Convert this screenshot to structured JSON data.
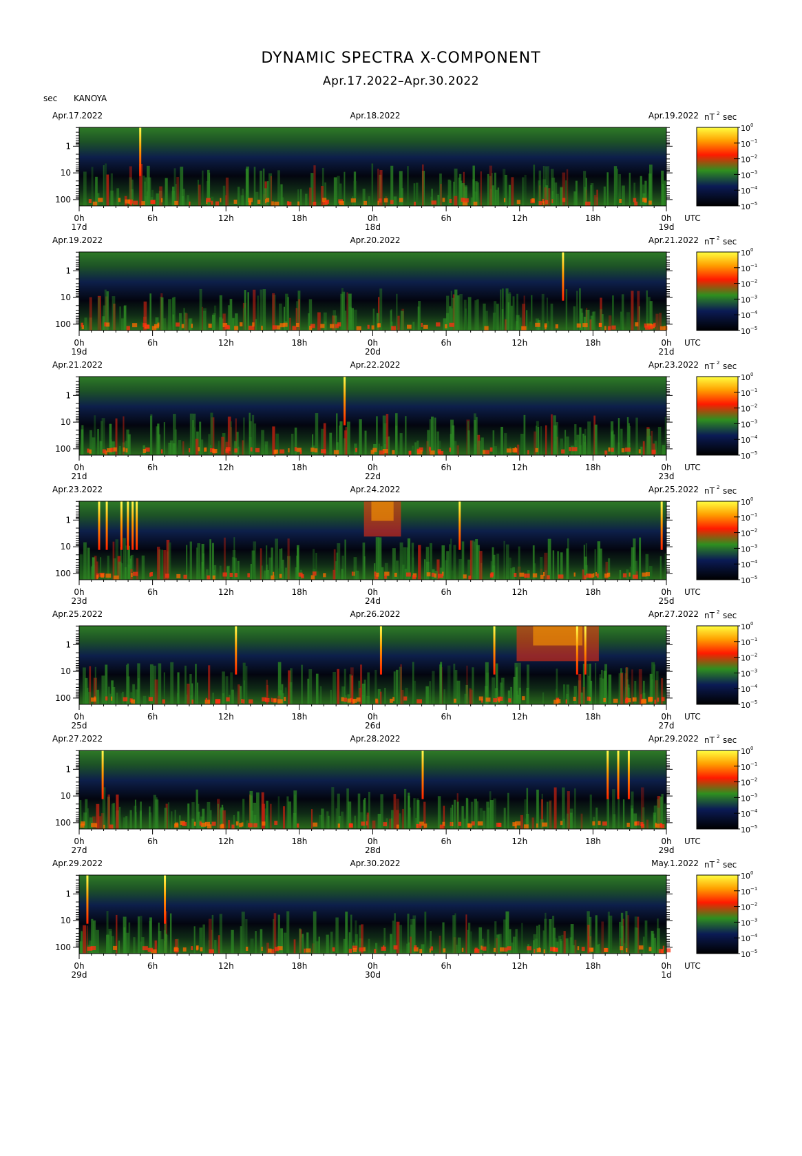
{
  "header": {
    "title": "DYNAMIC SPECTRA X-COMPONENT",
    "subtitle": "Apr.17.2022–Apr.30.2022",
    "y_unit": "sec",
    "station": "KANOYA"
  },
  "chart_data": {
    "type": "heatmap",
    "component": "X",
    "y_ticks": [
      "1",
      "10",
      "100"
    ],
    "x_ticks": [
      "0h",
      "6h",
      "12h",
      "18h",
      "0h",
      "6h",
      "12h",
      "18h",
      "0h"
    ],
    "x_unit": "UTC",
    "colorbar_unit": "nT",
    "colorbar_exponent": "2",
    "colorbar_unit2": "sec",
    "colorbar_ticks": [
      "10",
      "10",
      "10",
      "10",
      "10",
      "10"
    ],
    "colorbar_exps": [
      "0",
      "−1",
      "−2",
      "−3",
      "−4",
      "−5"
    ],
    "colorscale": [
      "#000000",
      "#0b1b55",
      "#1f5e1f",
      "#2f8f1f",
      "#ff2000",
      "#ff8a00",
      "#ffff40"
    ],
    "panels": [
      {
        "date_left": "Apr.17.2022",
        "date_mid": "Apr.18.2022",
        "date_right": "Apr.19.2022",
        "day_left": "17d",
        "day_mid": "18d",
        "day_right": "19d",
        "spikes": [
          0.104
        ],
        "events": []
      },
      {
        "date_left": "Apr.19.2022",
        "date_mid": "Apr.20.2022",
        "date_right": "Apr.21.2022",
        "day_left": "19d",
        "day_mid": "20d",
        "day_right": "21d",
        "spikes": [
          0.824
        ],
        "events": []
      },
      {
        "date_left": "Apr.21.2022",
        "date_mid": "Apr.22.2022",
        "date_right": "Apr.23.2022",
        "day_left": "21d",
        "day_mid": "22d",
        "day_right": "23d",
        "spikes": [
          0.452
        ],
        "events": []
      },
      {
        "date_left": "Apr.23.2022",
        "date_mid": "Apr.24.2022",
        "date_right": "Apr.25.2022",
        "day_left": "23d",
        "day_mid": "24d",
        "day_right": "25d",
        "spikes": [
          0.034,
          0.047,
          0.072,
          0.083,
          0.091,
          0.098,
          0.648,
          0.992
        ],
        "events": [
          {
            "start": 0.485,
            "end": 0.548
          }
        ]
      },
      {
        "date_left": "Apr.25.2022",
        "date_mid": "Apr.26.2022",
        "date_right": "Apr.27.2022",
        "day_left": "25d",
        "day_mid": "26d",
        "day_right": "27d",
        "spikes": [
          0.267,
          0.514,
          0.707,
          0.848,
          0.862
        ],
        "events": [
          {
            "start": 0.745,
            "end": 0.885
          }
        ]
      },
      {
        "date_left": "Apr.27.2022",
        "date_mid": "Apr.28.2022",
        "date_right": "Apr.29.2022",
        "day_left": "27d",
        "day_mid": "28d",
        "day_right": "29d",
        "spikes": [
          0.04,
          0.585,
          0.9,
          0.918,
          0.936
        ],
        "events": []
      },
      {
        "date_left": "Apr.29.2022",
        "date_mid": "Apr.30.2022",
        "date_right": "May.1.2022",
        "day_left": "29d",
        "day_mid": "30d",
        "day_right": "1d",
        "spikes": [
          0.014,
          0.146
        ],
        "events": []
      }
    ]
  }
}
